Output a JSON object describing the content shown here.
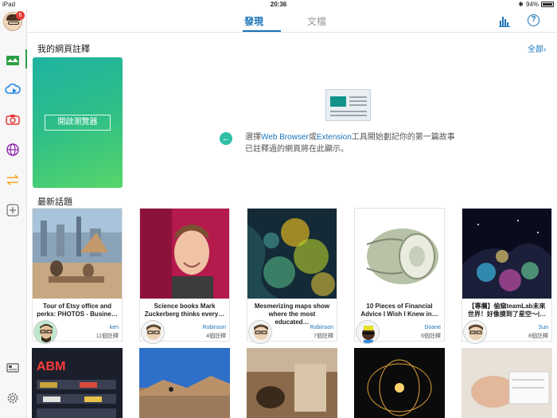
{
  "status": {
    "device": "iPad",
    "time": "20:36",
    "battery": "94%"
  },
  "sidebar": {
    "badge_count": "6",
    "items": [
      "inbox-icon",
      "cloud-icon",
      "camera-icon",
      "globe-icon",
      "sync-icon",
      "add-icon",
      "keyboard-icon",
      "settings-icon"
    ]
  },
  "header": {
    "tab_discover": "發現",
    "tab_docs": "文檔",
    "help": "?"
  },
  "annotations": {
    "title": "我的網頁註釋",
    "all_link": "全部",
    "open_browser": "開啟瀏覽器",
    "hint_a": "選擇",
    "hint_web": "Web Browser",
    "hint_b": "或",
    "hint_ext": "Extension",
    "hint_c": "工具開始劃記你的第一篇故事",
    "hint_line2": "已註釋過的網頁將在此顯示。"
  },
  "topics": {
    "title": "最新話題",
    "cards": [
      {
        "title": "Tour of Etsy office and perks: PHOTOS - Busine…",
        "user": "ken",
        "count": "11個註釋"
      },
      {
        "title": "Science books Mark Zuckerberg thinks every…",
        "user": "Robinson",
        "count": "4個註釋"
      },
      {
        "title": "Mesmerizing maps show where the most educated…",
        "user": "Robinson",
        "count": "7個註釋"
      },
      {
        "title": "10 Pieces of Financial Advice I Wish I Knew in…",
        "user": "Doane",
        "count": "6個註釋"
      },
      {
        "title": "【專欄】偷窺teamLab未來世界！好像摸到了星空～|…",
        "user": "Sun",
        "count": "8個註釋"
      }
    ],
    "row2_label": "ABM"
  },
  "colors": {
    "accent": "#1a73b8",
    "green_active": "#2e9e44",
    "card_gradient_start": "#1fb3a2",
    "card_gradient_end": "#57d66a"
  }
}
